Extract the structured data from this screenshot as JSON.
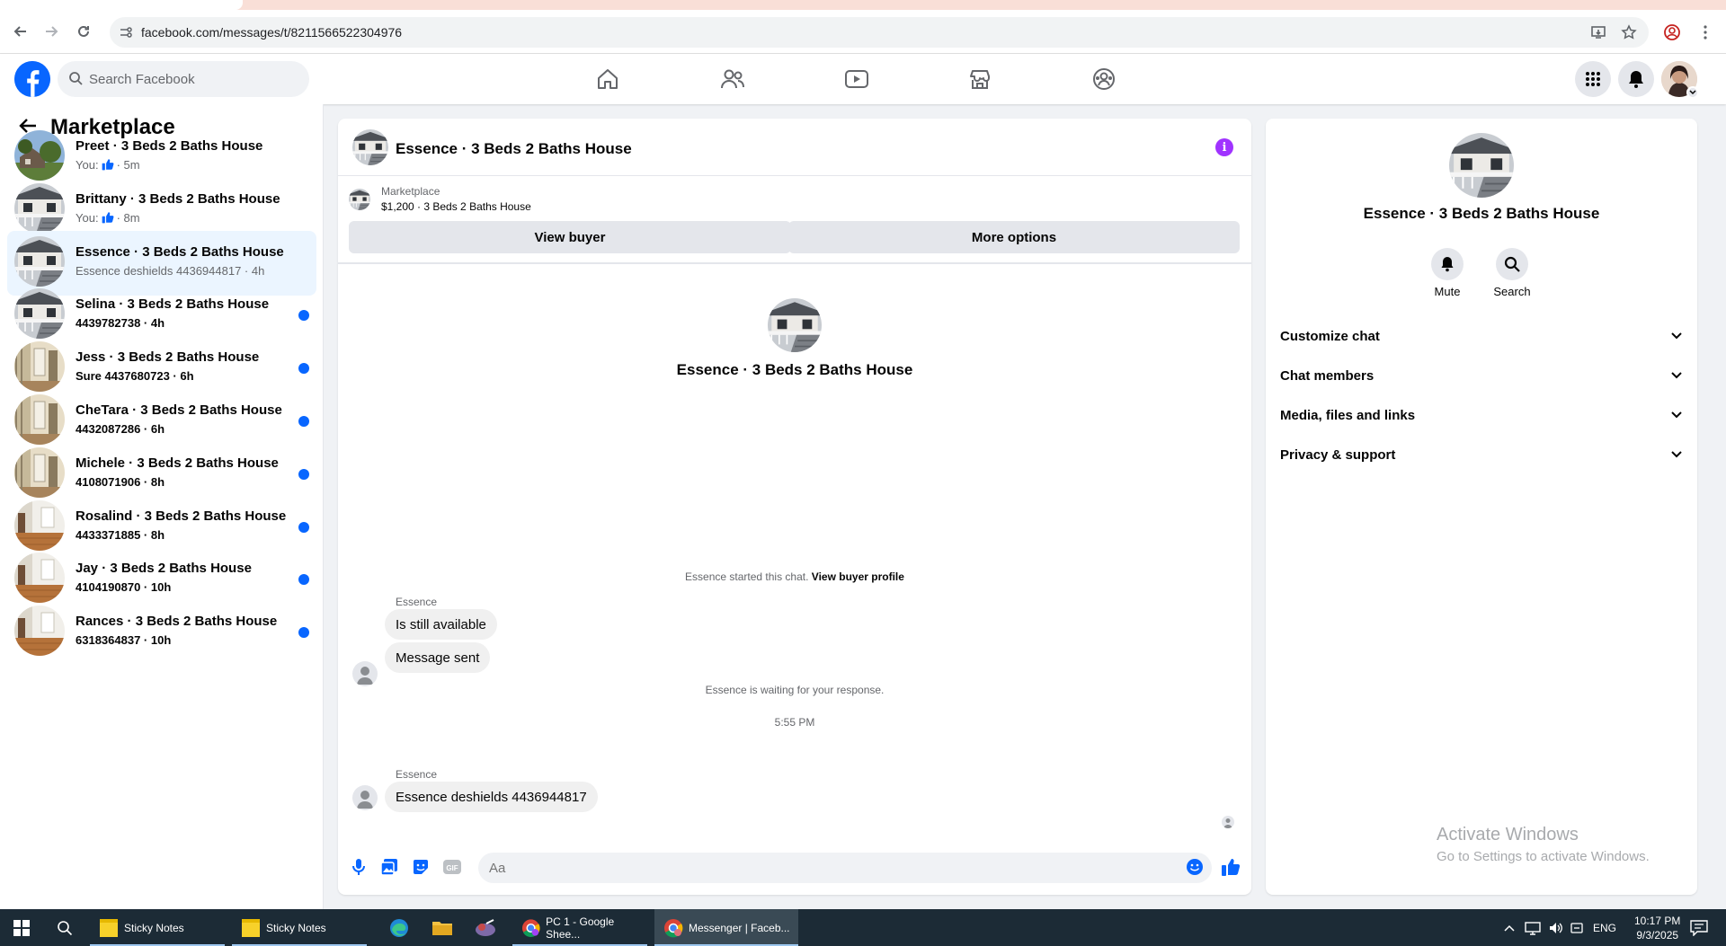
{
  "browser": {
    "url": "facebook.com/messages/t/8211566522304976"
  },
  "fb": {
    "search_placeholder": "Search Facebook"
  },
  "left": {
    "title": "Marketplace",
    "conversations": [
      {
        "name": "Preet · 3 Beds 2 Baths House",
        "sub": "You: 👍 · 5m",
        "pre": "You:",
        "post": "· 5m",
        "unread": false,
        "active": false,
        "img": "house1"
      },
      {
        "name": "Brittany · 3 Beds 2 Baths House",
        "sub": "You: 👍 · 8m",
        "pre": "You:",
        "post": "· 8m",
        "unread": false,
        "active": false,
        "img": "porch"
      },
      {
        "name": "Essence · 3 Beds 2 Baths House",
        "sub": "Essence deshields 4436944817 · 4h",
        "unread": false,
        "active": true,
        "img": "porch"
      },
      {
        "name": "Selina · 3 Beds 2 Baths House",
        "sub": "4439782738 · 4h",
        "unread": true,
        "active": false,
        "img": "porch"
      },
      {
        "name": "Jess · 3 Beds 2 Baths House",
        "sub": "Sure 4437680723 · 6h",
        "unread": true,
        "active": false,
        "img": "room"
      },
      {
        "name": "CheTara · 3 Beds 2 Baths House",
        "sub": "4432087286 · 6h",
        "unread": true,
        "active": false,
        "img": "room"
      },
      {
        "name": "Michele · 3 Beds 2 Baths House",
        "sub": "4108071906 · 8h",
        "unread": true,
        "active": false,
        "img": "room"
      },
      {
        "name": "Rosalind · 3 Beds 2 Baths House",
        "sub": "4433371885 · 8h",
        "unread": true,
        "active": false,
        "img": "floor"
      },
      {
        "name": "Jay · 3 Beds 2 Baths House",
        "sub": "4104190870 · 10h",
        "unread": true,
        "active": false,
        "img": "floor"
      },
      {
        "name": "Rances · 3 Beds 2 Baths House",
        "sub": "6318364837 · 10h",
        "unread": true,
        "active": false,
        "img": "floor"
      }
    ]
  },
  "chat": {
    "title": "Essence · 3 Beds 2 Baths House",
    "listing_source": "Marketplace",
    "listing_price": "$1,200 · 3 Beds 2 Baths House",
    "view_buyer": "View buyer",
    "more_options": "More options",
    "intro_name": "Essence · 3 Beds 2 Baths House",
    "started_text": "Essence started this chat.",
    "view_buyer_profile": "View buyer profile",
    "sender1": "Essence",
    "msg1": "Is still available",
    "msg2": "Message sent",
    "waiting": "Essence is waiting for your response.",
    "time": "5:55 PM",
    "sender2": "Essence",
    "msg3": "Essence deshields 4436944817",
    "input_placeholder": "Aa"
  },
  "right": {
    "name": "Essence · 3 Beds 2 Baths House",
    "mute": "Mute",
    "search": "Search",
    "sections": [
      "Customize chat",
      "Chat members",
      "Media, files and links",
      "Privacy & support"
    ]
  },
  "watermark": {
    "line1": "Activate Windows",
    "line2": "Go to Settings to activate Windows."
  },
  "taskbar": {
    "sticky1": "Sticky Notes",
    "sticky2": "Sticky Notes",
    "sheets": "PC 1 - Google Shee...",
    "messenger": "Messenger | Faceb...",
    "lang": "ENG",
    "time": "10:17 PM",
    "date": "9/3/2025"
  },
  "colors": {
    "fb_blue": "#0866ff",
    "unread_dot": "#0866ff",
    "active_row": "#ebf5ff",
    "info_purple": "#a033ff",
    "taskbar": "#1c2b36"
  }
}
